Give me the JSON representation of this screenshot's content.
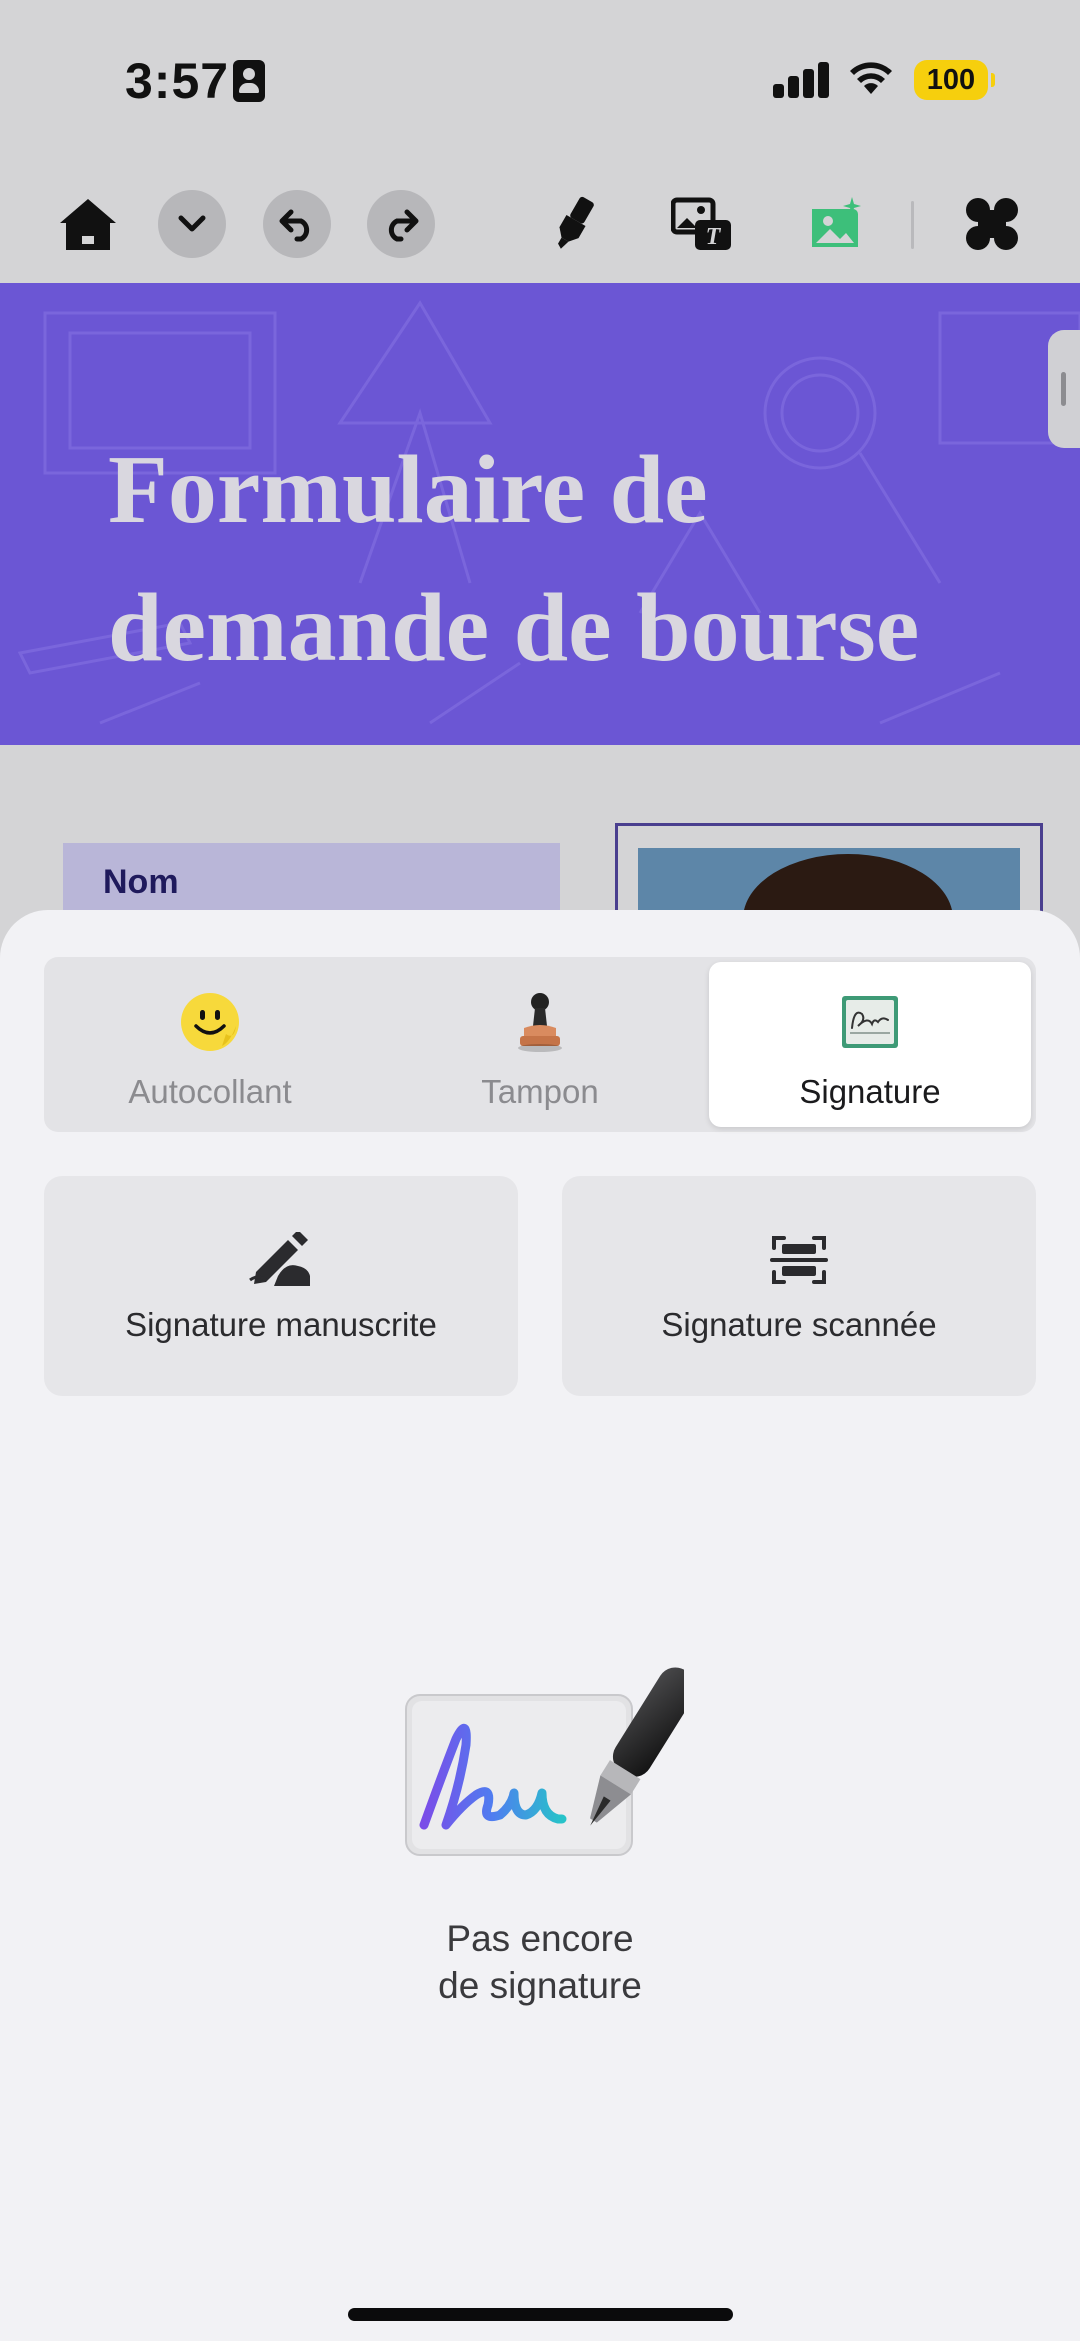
{
  "status_bar": {
    "time": "3:57",
    "battery": "100",
    "icons": [
      "contact-card-icon",
      "cellular-signal-icon",
      "wifi-icon",
      "battery-icon"
    ],
    "battery_color": "#f6cf0d"
  },
  "toolbar": {
    "icons": [
      "home-icon",
      "chevron-down-icon",
      "undo-icon",
      "redo-icon",
      "highlighter-icon",
      "image-text-icon",
      "add-signature-image-icon",
      "apps-grid-icon"
    ],
    "active_color": "#3dbf7a"
  },
  "document": {
    "banner_title_line1": "Formulaire de",
    "banner_title_line2": "demande de bourse",
    "banner_color": "#6b56d4",
    "field_label": "Nom"
  },
  "sheet": {
    "tabs": [
      {
        "label": "Autocollant",
        "icon": "smiley-sticker-icon",
        "active": false
      },
      {
        "label": "Tampon",
        "icon": "rubber-stamp-icon",
        "active": false
      },
      {
        "label": "Signature",
        "icon": "signature-icon",
        "active": true
      }
    ],
    "options": [
      {
        "label": "Signature manuscrite",
        "icon": "handwriting-pen-icon"
      },
      {
        "label": "Signature scannée",
        "icon": "scan-icon"
      }
    ],
    "empty_state": {
      "line1": "Pas encore",
      "line2": "de signature",
      "icon": "signature-pen-illustration"
    }
  }
}
